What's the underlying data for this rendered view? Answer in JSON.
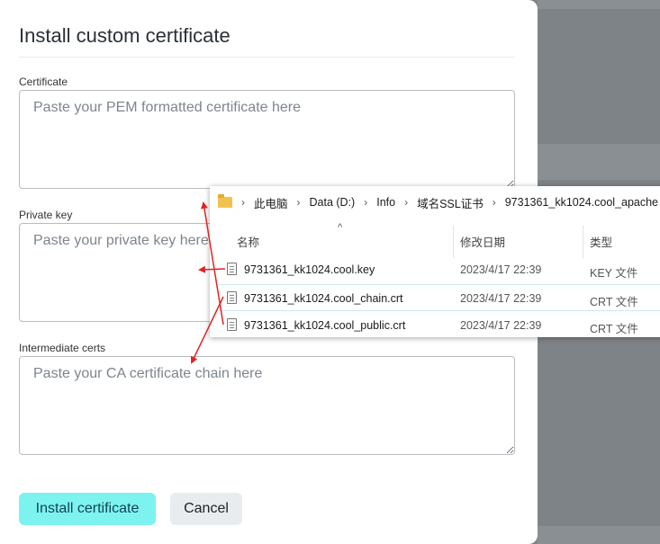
{
  "dialog": {
    "title": "Install custom certificate",
    "certificate": {
      "label": "Certificate",
      "placeholder": "Paste your PEM formatted certificate here"
    },
    "private_key": {
      "label": "Private key",
      "placeholder": "Paste your private key here"
    },
    "intermediate": {
      "label": "Intermediate certs",
      "placeholder": "Paste your CA certificate chain here"
    },
    "install_label": "Install certificate",
    "cancel_label": "Cancel"
  },
  "explorer": {
    "breadcrumb": [
      "此电脑",
      "Data (D:)",
      "Info",
      "域名SSL证书",
      "9731361_kk1024.cool_apache"
    ],
    "columns": {
      "name": "名称",
      "date": "修改日期",
      "type": "类型"
    },
    "files": [
      {
        "name": "9731361_kk1024.cool.key",
        "date": "2023/4/17 22:39",
        "type": "KEY 文件"
      },
      {
        "name": "9731361_kk1024.cool_chain.crt",
        "date": "2023/4/17 22:39",
        "type": "CRT 文件"
      },
      {
        "name": "9731361_kk1024.cool_public.crt",
        "date": "2023/4/17 22:39",
        "type": "CRT 文件"
      }
    ]
  },
  "colors": {
    "primary_button": "#7df3f0",
    "arrow": "#e02424"
  }
}
